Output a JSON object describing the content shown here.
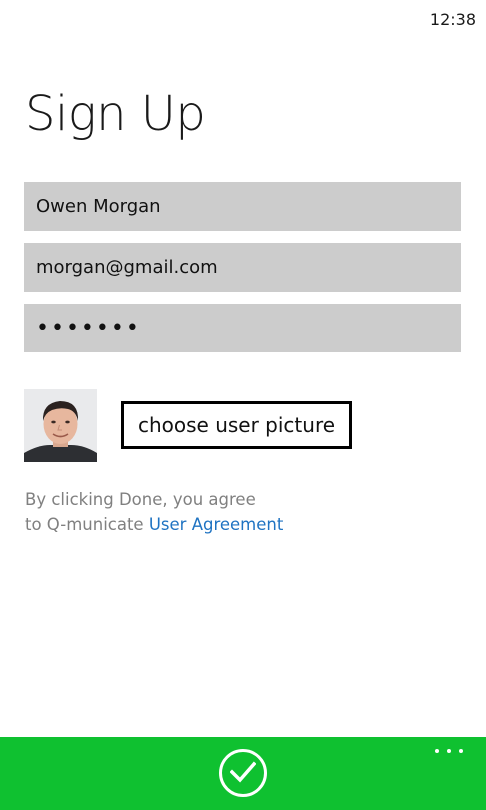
{
  "status_bar": {
    "time": "12:38"
  },
  "page": {
    "title": "Sign Up"
  },
  "form": {
    "name_value": "Owen Morgan",
    "email_value": "morgan@gmail.com",
    "password_value": "•••••••"
  },
  "picture": {
    "button_label": "choose user picture"
  },
  "agreement": {
    "line1": "By clicking Done, you agree",
    "line2_prefix": "to Q-municate ",
    "link_label": "User Agreement"
  },
  "app_bar": {
    "background_color": "#0fc130",
    "done_icon": "checkmark-icon",
    "more_icon": "ellipsis-icon"
  }
}
